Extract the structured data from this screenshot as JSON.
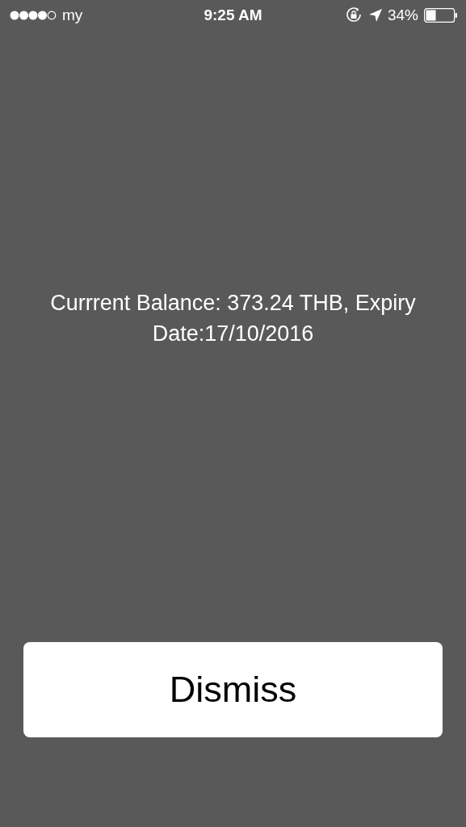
{
  "status_bar": {
    "carrier": "my",
    "time": "9:25 AM",
    "battery": "34%"
  },
  "message": "Currrent Balance: 373.24 THB, Expiry Date:17/10/2016",
  "buttons": [
    {
      "label": "Dismiss"
    }
  ]
}
